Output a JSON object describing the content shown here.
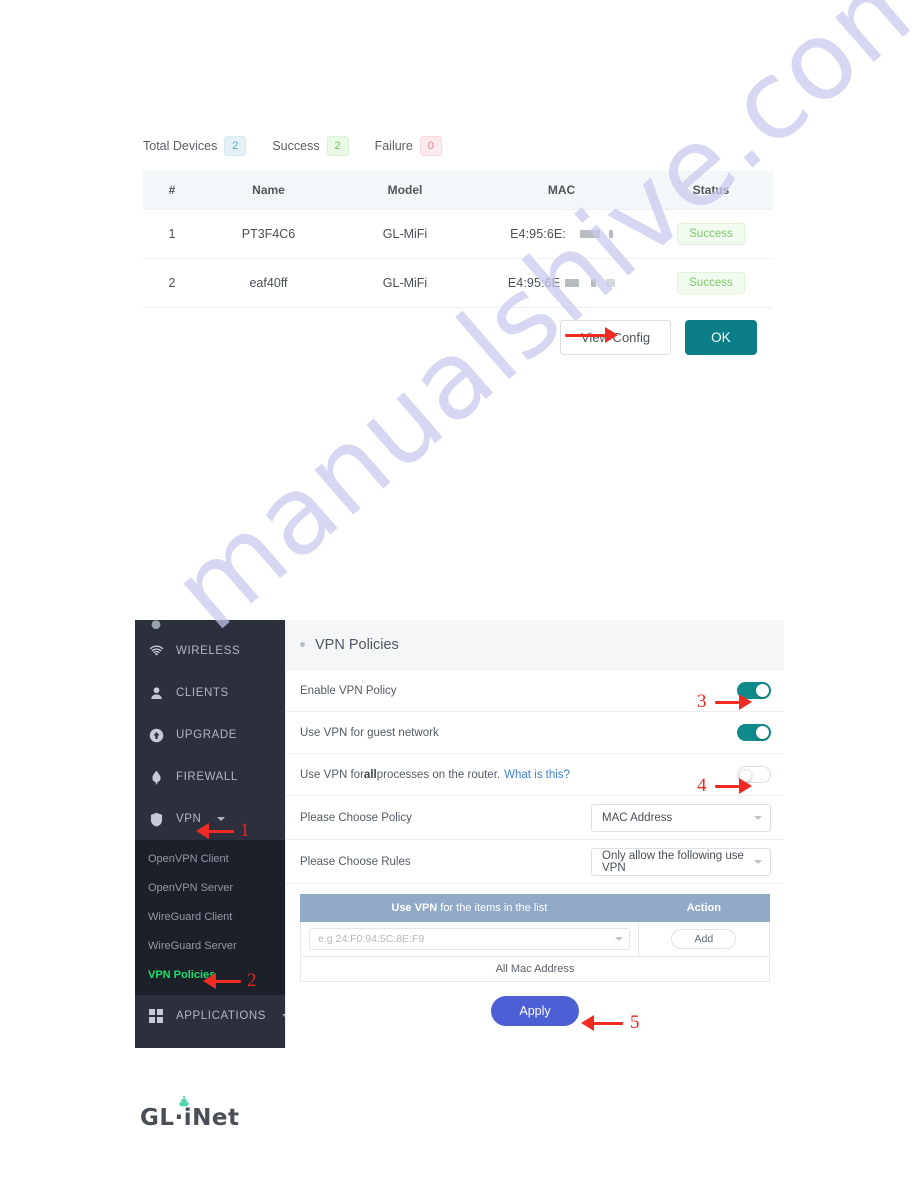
{
  "watermark": {
    "text": "manualshive.com"
  },
  "top_panel": {
    "summary": [
      {
        "label": "Total Devices",
        "count": "2",
        "kind": "total"
      },
      {
        "label": "Success",
        "count": "2",
        "kind": "success"
      },
      {
        "label": "Failure",
        "count": "0",
        "kind": "failure"
      }
    ],
    "table": {
      "columns": [
        "#",
        "Name",
        "Model",
        "MAC",
        "Status"
      ],
      "rows": [
        {
          "index": "1",
          "name": "PT3F4C6",
          "model": "GL-MiFi",
          "mac": "E4:95:6E:",
          "status": "Success"
        },
        {
          "index": "2",
          "name": "eaf40ff",
          "model": "GL-MiFi",
          "mac": "E4:95:6E",
          "status": "Success"
        }
      ]
    },
    "buttons": {
      "view_config": "View Config",
      "ok": "OK"
    }
  },
  "router_ui": {
    "sidebar": {
      "items": [
        {
          "label": "WIRELESS",
          "icon": "wifi-icon",
          "has_caret": false
        },
        {
          "label": "CLIENTS",
          "icon": "user-icon",
          "has_caret": false
        },
        {
          "label": "UPGRADE",
          "icon": "upgrade-arrow-icon",
          "has_caret": false
        },
        {
          "label": "FIREWALL",
          "icon": "flame-icon",
          "has_caret": false
        },
        {
          "label": "VPN",
          "icon": "shield-icon",
          "has_caret": true
        }
      ],
      "submenu": [
        {
          "label": "OpenVPN Client",
          "active": false
        },
        {
          "label": "OpenVPN Server",
          "active": false
        },
        {
          "label": "WireGuard Client",
          "active": false
        },
        {
          "label": "WireGuard Server",
          "active": false
        },
        {
          "label": "VPN Policies",
          "active": true
        }
      ],
      "applications": {
        "label": "APPLICATIONS",
        "icon": "grid-icon",
        "has_caret": true
      }
    },
    "content": {
      "title": "VPN Policies",
      "rows": [
        {
          "label": "Enable VPN Policy",
          "toggle": "on"
        },
        {
          "label": "Use VPN for guest network",
          "toggle": "on"
        }
      ],
      "all_processes": {
        "prefix": "Use VPN for ",
        "bold": "all",
        "middle": " processes on the router.",
        "link": "What is this?",
        "toggle": "off"
      },
      "policy": {
        "label": "Please Choose Policy",
        "value": "MAC Address"
      },
      "rules": {
        "label": "Please Choose Rules",
        "value": "Only allow the following use VPN"
      },
      "list_table": {
        "header_bold": "Use VPN",
        "header_rest": " for the items in the list",
        "header_action": "Action",
        "input_placeholder": "e.g 24:F0:94:5C:8E:F9",
        "add_label": "Add",
        "all_mac_label": "All Mac Address"
      },
      "apply_label": "Apply"
    }
  },
  "annotations": {
    "markers": [
      "1",
      "2",
      "3",
      "4",
      "5"
    ]
  },
  "footer": {
    "logo_left": "GL",
    "logo_sep": "·",
    "logo_right": "iNet"
  },
  "colors": {
    "teal": "#0f8a8a",
    "ok_button": "#0a7d86",
    "apply_button": "#4d5fd4",
    "arrow_red": "#ef2b24",
    "active_green": "#19e06a",
    "sidebar_bg": "#2b303c",
    "submenu_bg": "#1c2029",
    "list_header_blue": "#90aac8",
    "watermark": "#c9c9ef"
  }
}
